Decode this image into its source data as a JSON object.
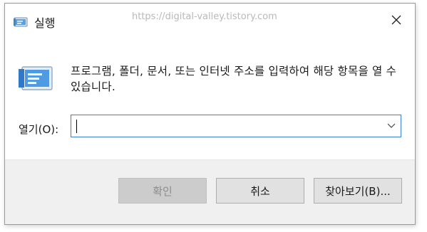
{
  "window": {
    "title": "실행",
    "watermark": "https://digital-valley.tistory.com",
    "close_icon": "close-icon"
  },
  "main": {
    "description": "프로그램, 폴더, 문서, 또는 인터넷 주소를 입력하여 해당 항목을 열 수 있습니다.",
    "open_label": "열기(O):",
    "open_value": "",
    "icon": "run-icon"
  },
  "buttons": {
    "ok": "확인",
    "cancel": "취소",
    "browse": "찾아보기(B)..."
  },
  "colors": {
    "accent": "#3b7ed6",
    "footer_bg": "#f0f0f0",
    "button_bg": "#e1e1e1",
    "disabled_bg": "#cccccc"
  }
}
